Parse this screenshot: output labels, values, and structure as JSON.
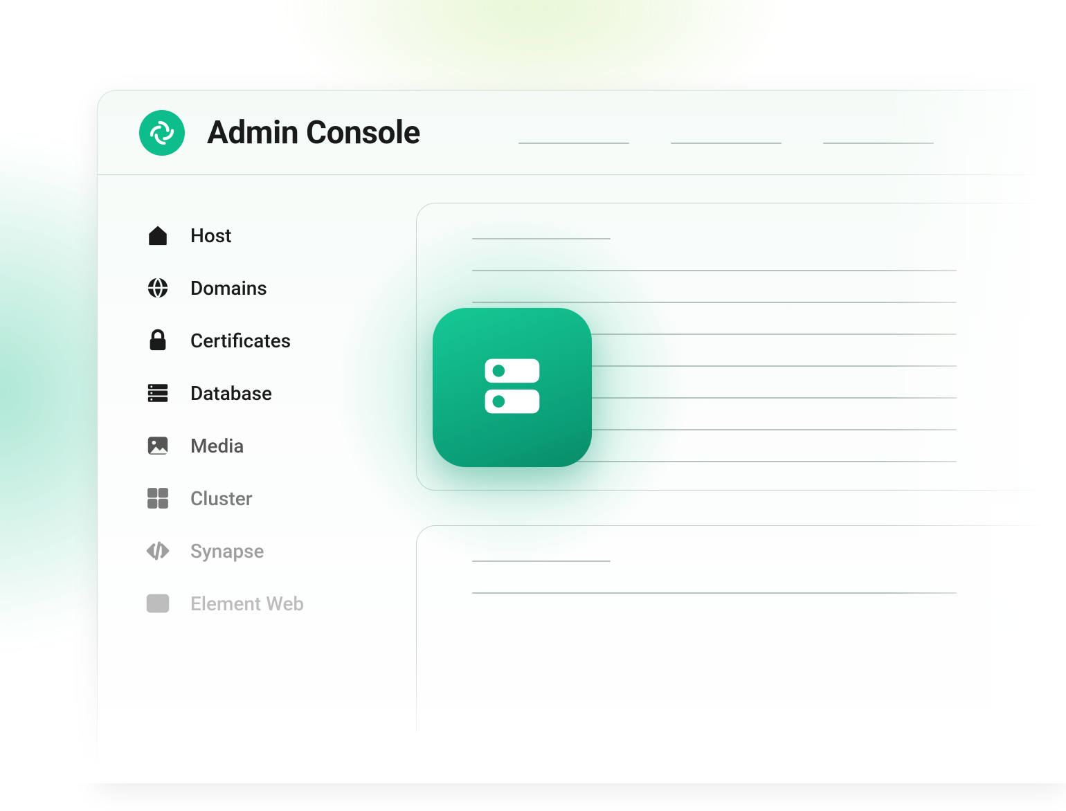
{
  "header": {
    "title": "Admin Console",
    "logo_icon": "element-logo"
  },
  "sidebar": {
    "items": [
      {
        "icon": "home-icon",
        "label": "Host"
      },
      {
        "icon": "globe-icon",
        "label": "Domains"
      },
      {
        "icon": "lock-icon",
        "label": "Certificates"
      },
      {
        "icon": "database-icon",
        "label": "Database"
      },
      {
        "icon": "image-icon",
        "label": "Media"
      },
      {
        "icon": "grid-icon",
        "label": "Cluster"
      },
      {
        "icon": "code-icon",
        "label": "Synapse"
      },
      {
        "icon": "window-icon",
        "label": "Element Web"
      }
    ]
  },
  "center_badge": {
    "icon": "server-icon"
  }
}
